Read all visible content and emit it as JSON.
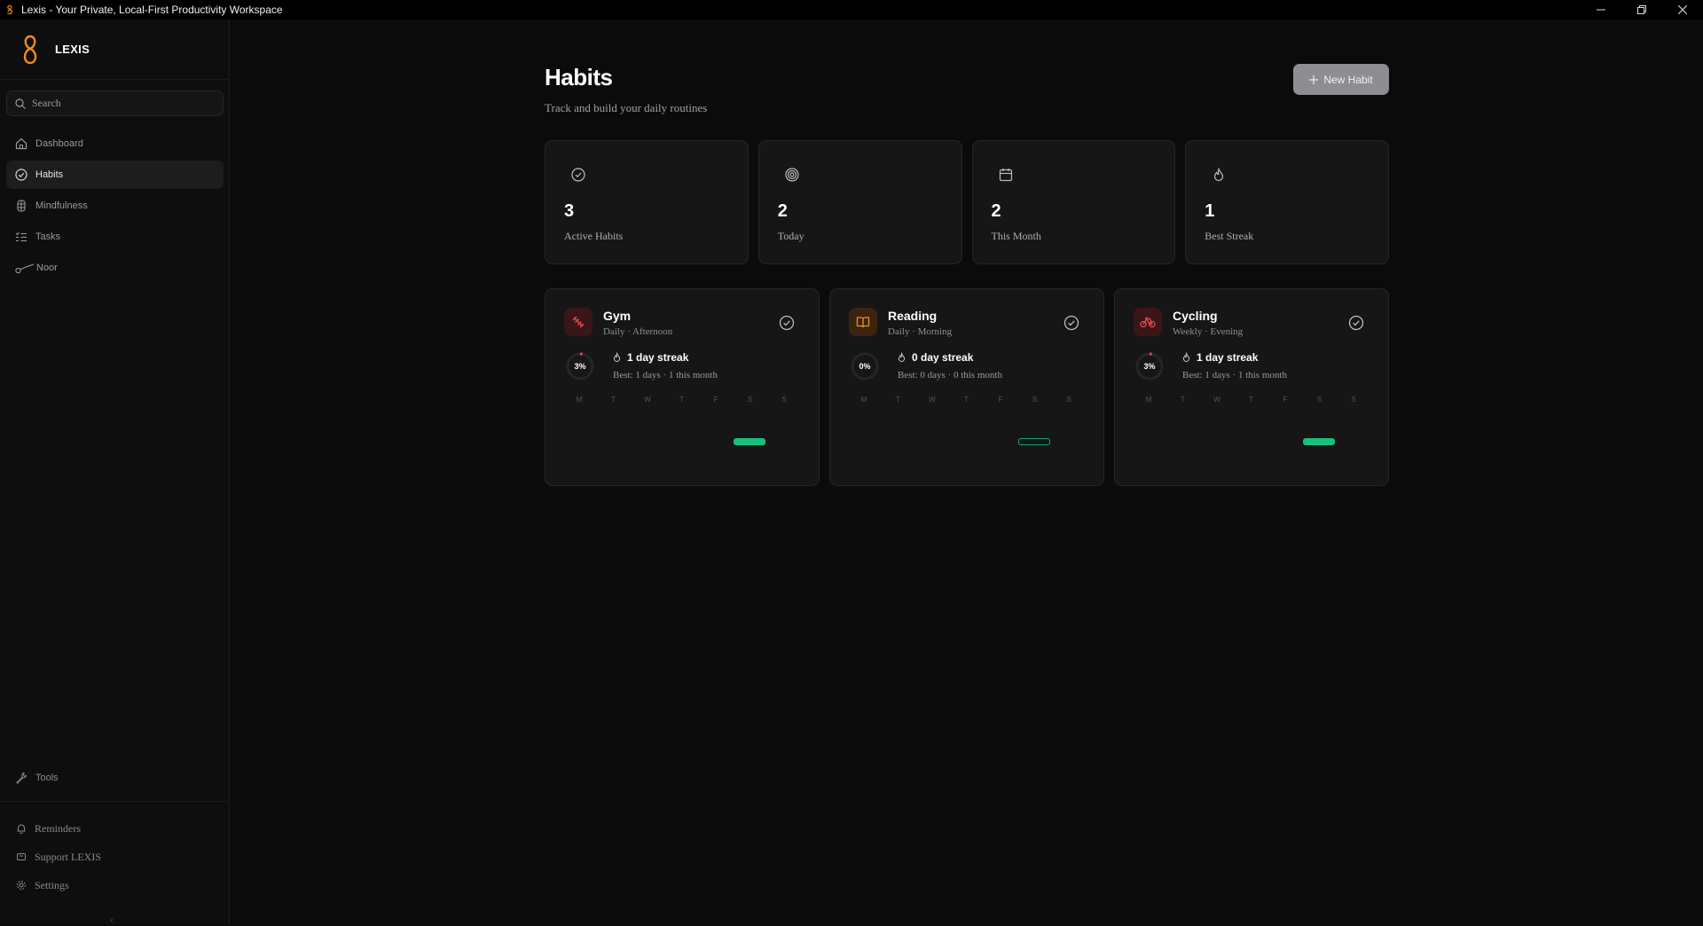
{
  "window": {
    "title": "Lexis - Your Private, Local-First Productivity Workspace"
  },
  "sidebar": {
    "brand": "LEXIS",
    "search_placeholder": "Search",
    "items": [
      {
        "label": "Dashboard",
        "icon": "home-icon",
        "active": false
      },
      {
        "label": "Habits",
        "icon": "check-circle-icon",
        "active": true
      },
      {
        "label": "Mindfulness",
        "icon": "mindfulness-icon",
        "active": false
      },
      {
        "label": "Tasks",
        "icon": "list-check-icon",
        "active": false
      },
      {
        "label": "Noor",
        "icon": "noor-icon",
        "active": false
      }
    ],
    "tools_label": "Tools",
    "bottom_links": [
      {
        "label": "Reminders",
        "icon": "bell-icon"
      },
      {
        "label": "Support LEXIS",
        "icon": "support-icon"
      },
      {
        "label": "Settings",
        "icon": "gear-icon"
      }
    ]
  },
  "header": {
    "title": "Habits",
    "subtitle": "Track and build your daily routines",
    "new_button": "New Habit"
  },
  "stats": [
    {
      "value": "3",
      "label": "Active Habits",
      "icon": "check-circle-icon"
    },
    {
      "value": "2",
      "label": "Today",
      "icon": "target-icon"
    },
    {
      "value": "2",
      "label": "This Month",
      "icon": "calendar-icon"
    },
    {
      "value": "1",
      "label": "Best Streak",
      "icon": "flame-icon"
    }
  ],
  "habits": [
    {
      "name": "Gym",
      "frequency": "Daily · Afternoon",
      "icon": "dumbbell-icon",
      "icon_color": "#e5484d",
      "icon_bg": "#3a1619",
      "percent_label": "3%",
      "percent": 3,
      "streak": "1 day streak",
      "best": "Best: 1 days · 1 this month",
      "days": [
        "M",
        "T",
        "W",
        "T",
        "F",
        "S",
        "S"
      ],
      "bar": "filled"
    },
    {
      "name": "Reading",
      "frequency": "Daily · Morning",
      "icon": "book-icon",
      "icon_color": "#f0921f",
      "icon_bg": "#3a2410",
      "percent_label": "0%",
      "percent": 0,
      "streak": "0 day streak",
      "best": "Best: 0 days · 0 this month",
      "days": [
        "M",
        "T",
        "W",
        "T",
        "F",
        "S",
        "S"
      ],
      "bar": "outline"
    },
    {
      "name": "Cycling",
      "frequency": "Weekly · Evening",
      "icon": "bicycle-icon",
      "icon_color": "#e5484d",
      "icon_bg": "#3a1619",
      "percent_label": "3%",
      "percent": 3,
      "streak": "1 day streak",
      "best": "Best: 1 days · 1 this month",
      "days": [
        "M",
        "T",
        "W",
        "T",
        "F",
        "S",
        "S"
      ],
      "bar": "filled"
    }
  ],
  "colors": {
    "accent_orange": "#f28a1e",
    "success_green": "#17c07c",
    "danger_red": "#e5484d"
  }
}
